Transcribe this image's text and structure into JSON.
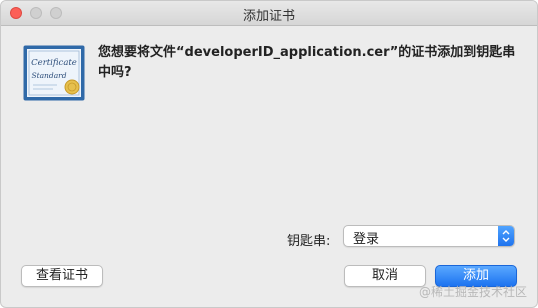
{
  "window": {
    "title": "添加证书"
  },
  "message": "您想要将文件“developerID_application.cer”的证书添加到钥匙串中吗?",
  "certificate_icon": {
    "line1": "Certificate",
    "line2": "Standard",
    "colors": {
      "frame": "#2f69a8",
      "paper": "#eef4fb",
      "seal": "#e6c04d"
    }
  },
  "keychain": {
    "label": "钥匙串:",
    "value": "登录"
  },
  "buttons": {
    "view_certificates": "查看证书",
    "cancel": "取消",
    "add": "添加"
  },
  "watermark": "@稀土掘金技术社区",
  "colors": {
    "accent": "#1c73f0",
    "close": "#fc5f57"
  }
}
